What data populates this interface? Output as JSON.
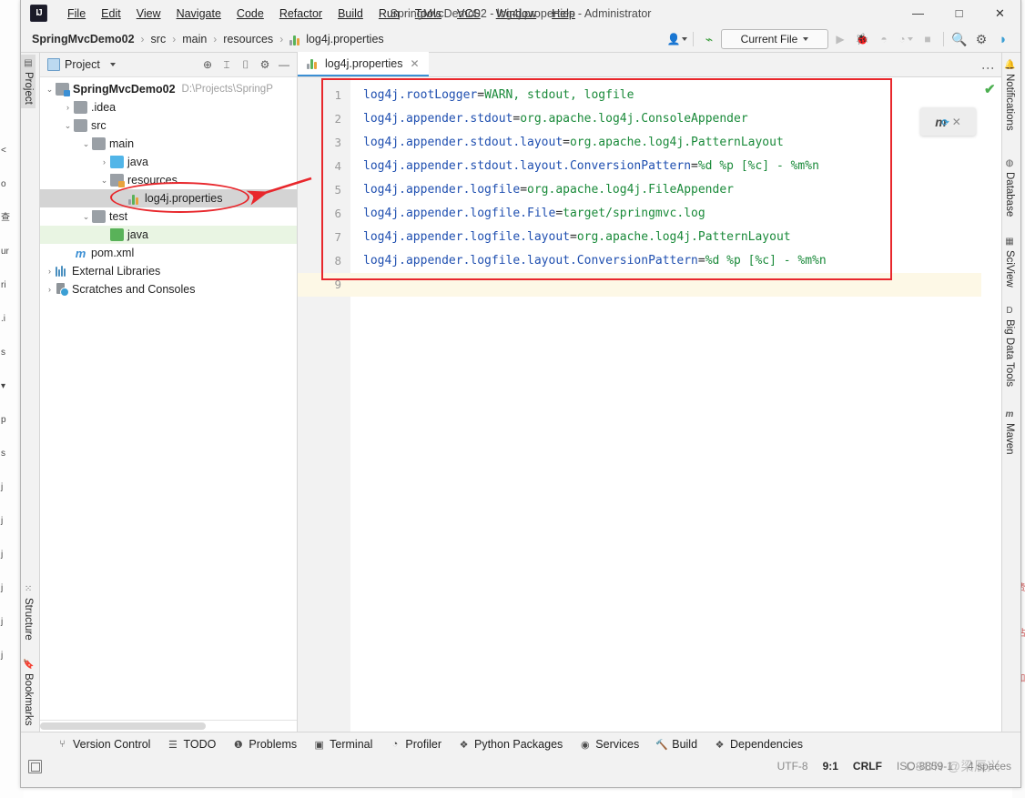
{
  "window": {
    "title": "SpringMvcDemo02 - log4j.properties - Administrator",
    "minimize": "—",
    "maximize": "□",
    "close": "✕",
    "logo": "IJ"
  },
  "menu": {
    "items": [
      {
        "label": "File"
      },
      {
        "label": "Edit"
      },
      {
        "label": "View"
      },
      {
        "label": "Navigate"
      },
      {
        "label": "Code"
      },
      {
        "label": "Refactor"
      },
      {
        "label": "Build"
      },
      {
        "label": "Run"
      },
      {
        "label": "Tools"
      },
      {
        "label": "VCS"
      },
      {
        "label": "Window"
      },
      {
        "label": "Help"
      }
    ]
  },
  "breadcrumb": {
    "separator": "›",
    "items": [
      {
        "label": "SpringMvcDemo02",
        "bold": true
      },
      {
        "label": "src",
        "bold": false
      },
      {
        "label": "main",
        "bold": false
      },
      {
        "label": "resources",
        "bold": false
      },
      {
        "label": "log4j.properties",
        "bold": false
      }
    ]
  },
  "toolbar": {
    "run_config": "Current File",
    "icons": [
      {
        "name": "user-avatar-icon",
        "glyph": "👤"
      },
      {
        "name": "build-hammer-icon",
        "glyph": "🔨"
      },
      {
        "name": "run-icon",
        "glyph": "▶"
      },
      {
        "name": "debug-icon",
        "glyph": "🐞"
      },
      {
        "name": "run-coverage-icon",
        "glyph": "◐"
      },
      {
        "name": "profile-icon",
        "glyph": "◔"
      },
      {
        "name": "stop-icon",
        "glyph": "■"
      },
      {
        "name": "search-everywhere-icon",
        "glyph": "🔍"
      },
      {
        "name": "settings-gear-icon",
        "glyph": "⚙"
      },
      {
        "name": "ide-assistant-icon",
        "glyph": "◗"
      }
    ]
  },
  "left_strip": {
    "top": [
      {
        "label": "Project",
        "active": true
      }
    ],
    "bottom": [
      {
        "label": "Structure"
      },
      {
        "label": "Bookmarks"
      }
    ]
  },
  "right_strip": {
    "items": [
      {
        "label": "Notifications",
        "icon": "🔔"
      },
      {
        "label": "Database",
        "icon": "⬤"
      },
      {
        "label": "SciView",
        "icon": "▦"
      },
      {
        "label": "Big Data Tools",
        "icon": "D"
      },
      {
        "label": "Maven",
        "icon": "m"
      }
    ]
  },
  "project_panel": {
    "title": "Project",
    "header_icons": [
      {
        "name": "select-opened-file-icon",
        "glyph": "⊕"
      },
      {
        "name": "expand-all-icon",
        "glyph": "⌶"
      },
      {
        "name": "collapse-all-icon",
        "glyph": "⌷"
      },
      {
        "name": "panel-settings-icon",
        "glyph": "⚙"
      },
      {
        "name": "hide-panel-icon",
        "glyph": "—"
      }
    ],
    "tree": [
      {
        "label": "SpringMvcDemo02",
        "path": "D:\\Projects\\SpringP",
        "indent": 0,
        "arrow": "v",
        "icon": "module",
        "bold": true,
        "state": "none"
      },
      {
        "label": ".idea",
        "path": "",
        "indent": 1,
        "arrow": ">",
        "icon": "folder",
        "bold": false,
        "state": "none"
      },
      {
        "label": "src",
        "path": "",
        "indent": 1,
        "arrow": "v",
        "icon": "folder",
        "bold": false,
        "state": "none"
      },
      {
        "label": "main",
        "path": "",
        "indent": 2,
        "arrow": "v",
        "icon": "folder",
        "bold": false,
        "state": "none"
      },
      {
        "label": "java",
        "path": "",
        "indent": 3,
        "arrow": ">",
        "icon": "folder-blue",
        "bold": false,
        "state": "none"
      },
      {
        "label": "resources",
        "path": "",
        "indent": 3,
        "arrow": "v",
        "icon": "folder-resources",
        "bold": false,
        "state": "none"
      },
      {
        "label": "log4j.properties",
        "path": "",
        "indent": 4,
        "arrow": "",
        "icon": "properties-file",
        "bold": false,
        "state": "selected"
      },
      {
        "label": "test",
        "path": "",
        "indent": 2,
        "arrow": "v",
        "icon": "folder",
        "bold": false,
        "state": "none"
      },
      {
        "label": "java",
        "path": "",
        "indent": 3,
        "arrow": "",
        "icon": "folder-green",
        "bold": false,
        "state": "green"
      },
      {
        "label": "pom.xml",
        "path": "",
        "indent": 1,
        "arrow": "",
        "icon": "maven-file",
        "bold": false,
        "state": "none"
      },
      {
        "label": "External Libraries",
        "path": "",
        "indent": 0,
        "arrow": ">",
        "icon": "libraries",
        "bold": false,
        "state": "none"
      },
      {
        "label": "Scratches and Consoles",
        "path": "",
        "indent": 0,
        "arrow": ">",
        "icon": "scratches",
        "bold": false,
        "state": "none"
      }
    ]
  },
  "editor": {
    "tab": {
      "label": "log4j.properties",
      "close": "✕"
    },
    "overflow_menu": "⋮",
    "inspection_status": "✔",
    "maven_popup": {
      "icon": "m",
      "close": "✕"
    },
    "line_numbers": [
      "1",
      "2",
      "3",
      "4",
      "5",
      "6",
      "7",
      "8",
      "9"
    ],
    "current_line": 9,
    "lines": [
      {
        "key": "log4j.rootLogger",
        "eq": "=",
        "value": "WARN, stdout, logfile"
      },
      {
        "key": "log4j.appender.stdout",
        "eq": "=",
        "value": "org.apache.log4j.ConsoleAppender"
      },
      {
        "key": "log4j.appender.stdout.layout",
        "eq": "=",
        "value": "org.apache.log4j.PatternLayout"
      },
      {
        "key": "log4j.appender.stdout.layout.ConversionPattern",
        "eq": "=",
        "value": "%d %p [%c] - %m%n"
      },
      {
        "key": "log4j.appender.logfile",
        "eq": "=",
        "value": "org.apache.log4j.FileAppender"
      },
      {
        "key": "log4j.appender.logfile.File",
        "eq": "=",
        "value": "target/springmvc.log"
      },
      {
        "key": "log4j.appender.logfile.layout",
        "eq": "=",
        "value": "org.apache.log4j.PatternLayout"
      },
      {
        "key": "log4j.appender.logfile.layout.ConversionPattern",
        "eq": "=",
        "value": "%d %p [%c] - %m%n"
      },
      {
        "key": "",
        "eq": "",
        "value": ""
      }
    ]
  },
  "bottom_toolbar": {
    "items": [
      {
        "label": "Version Control",
        "icon": "⑂"
      },
      {
        "label": "TODO",
        "icon": "☰"
      },
      {
        "label": "Problems",
        "icon": "❶"
      },
      {
        "label": "Terminal",
        "icon": "▣"
      },
      {
        "label": "Profiler",
        "icon": "◔"
      },
      {
        "label": "Python Packages",
        "icon": "❖"
      },
      {
        "label": "Services",
        "icon": "◉"
      },
      {
        "label": "Build",
        "icon": "🔨"
      },
      {
        "label": "Dependencies",
        "icon": "❖"
      }
    ]
  },
  "statusbar": {
    "encoding": "UTF-8",
    "caret": "9:1",
    "line_separator": "CRLF",
    "file_encoding": "ISO-8859-1",
    "indent": "4 spaces",
    "watermark": "CSDN @梁辰兴"
  },
  "background_window": {
    "left_fragments": [
      "<",
      "o",
      "查",
      "ur",
      "ri",
      ".i",
      "s",
      "",
      "▾",
      "",
      "p",
      "s",
      "j",
      "j",
      "j",
      "j",
      "j",
      "j"
    ],
    "right_fragments": [
      "费",
      "站",
      "和"
    ]
  },
  "colors": {
    "accent_blue": "#3b8fd4",
    "annotation_red": "#e8272c",
    "key_color": "#1f4fb0",
    "value_color": "#1a8a3a",
    "selected_row": "#d4d4d4",
    "green_row": "#e9f5e3",
    "current_line": "#fdf8e6"
  }
}
